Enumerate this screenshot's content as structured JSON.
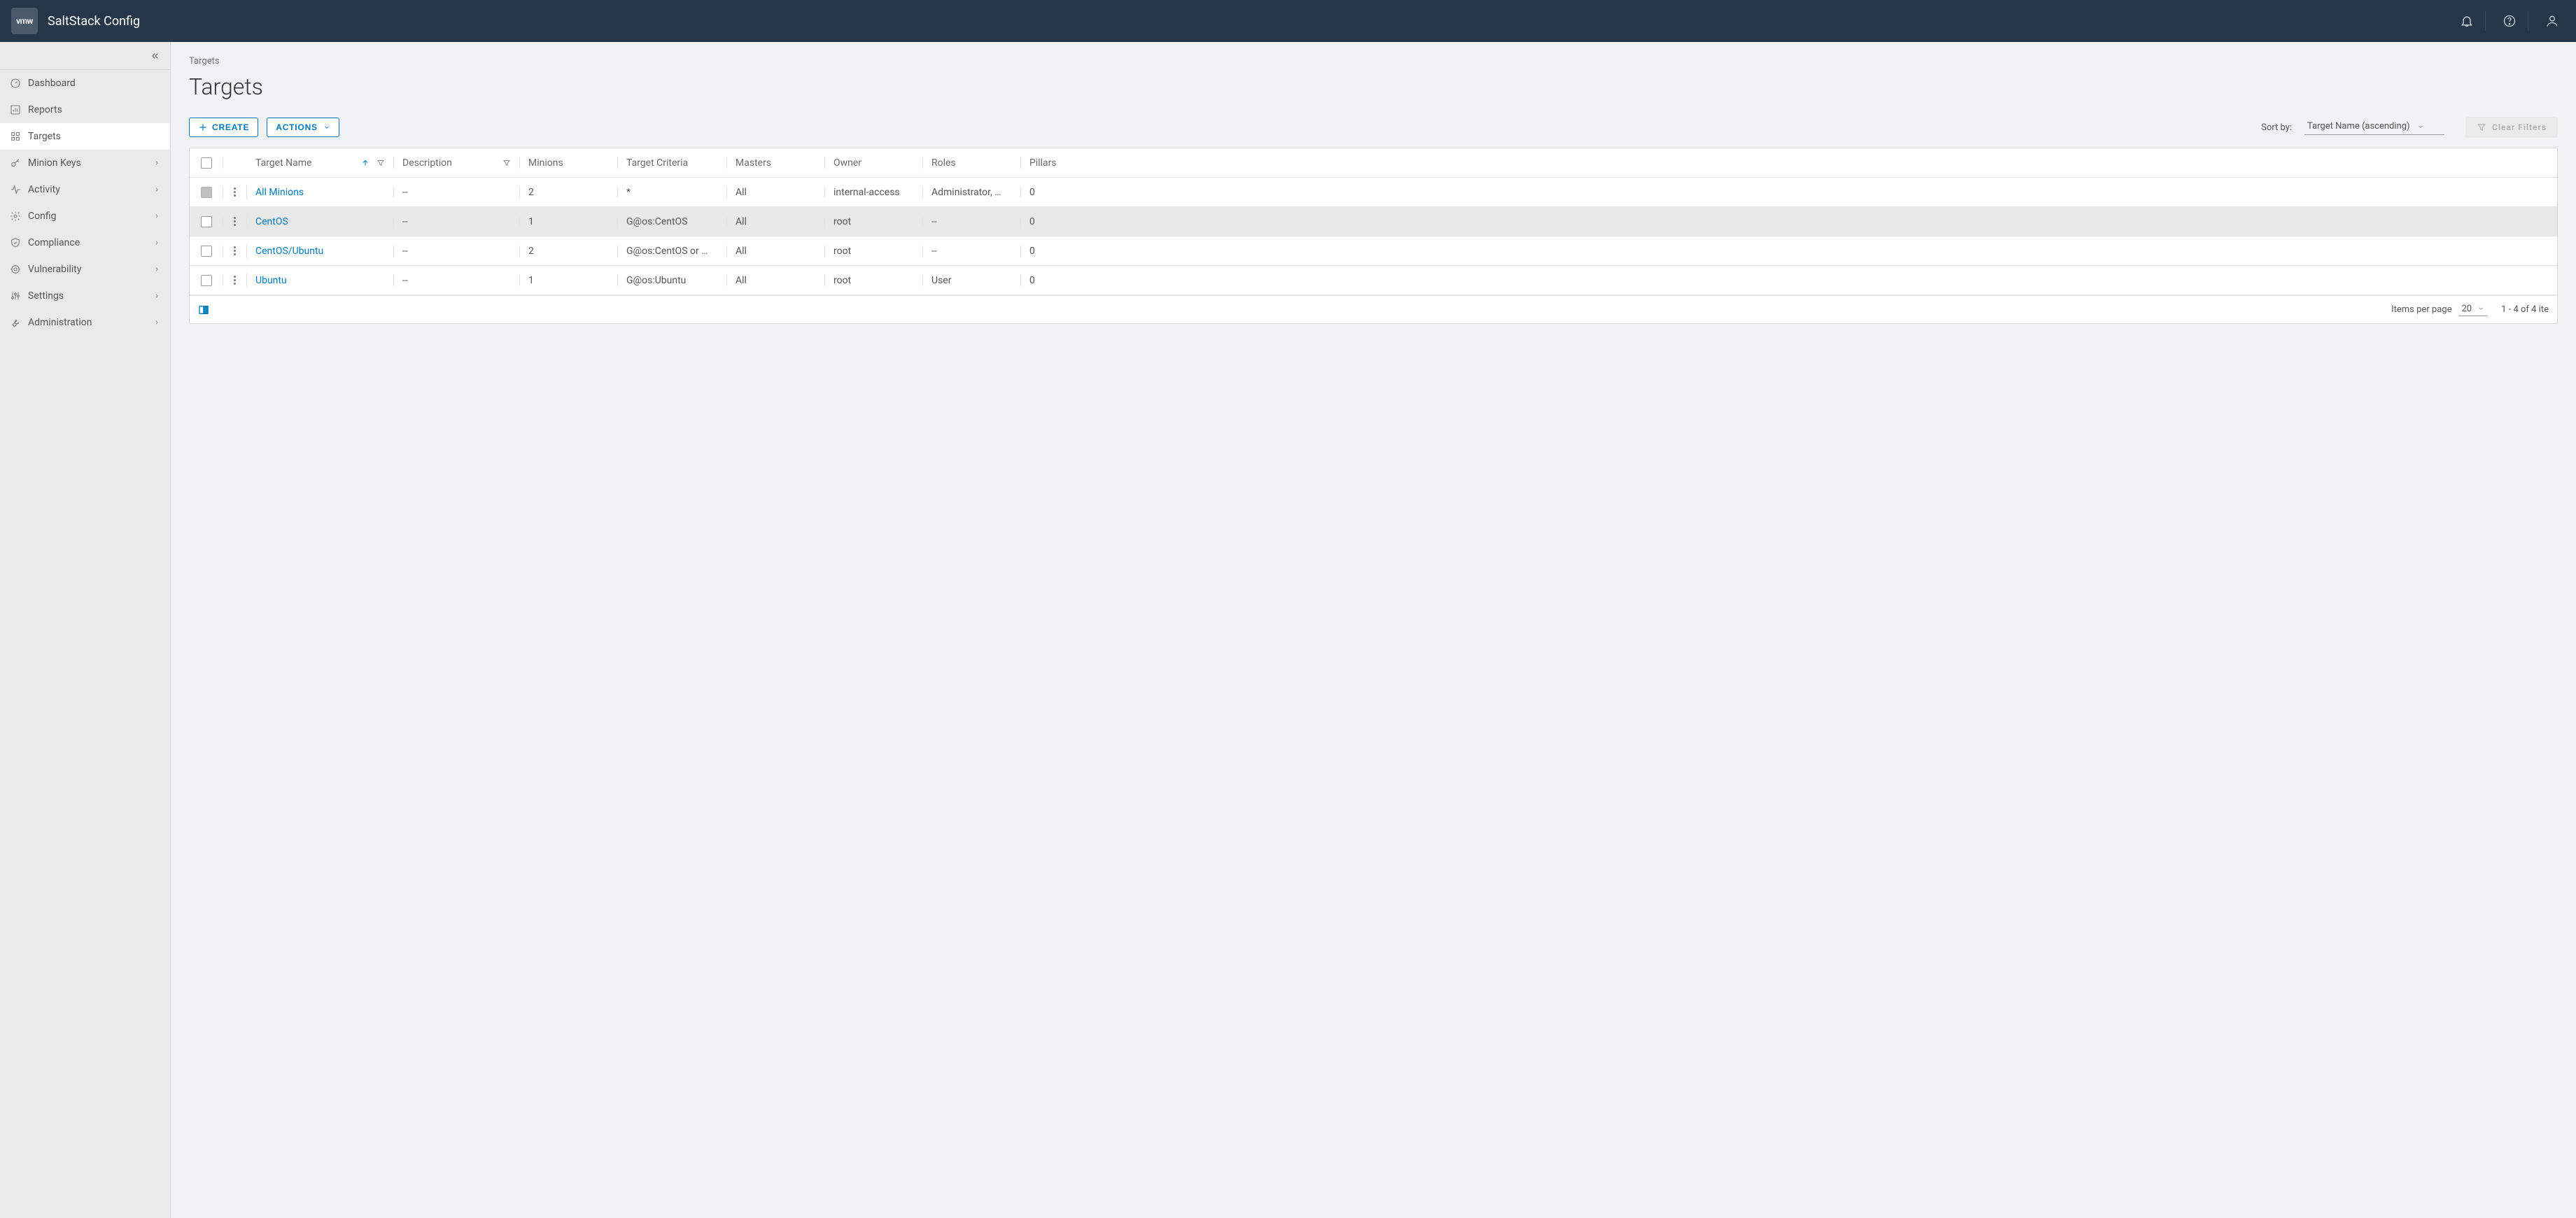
{
  "header": {
    "logo_text": "vmw",
    "app_title": "SaltStack Config"
  },
  "sidebar": {
    "items": [
      {
        "label": "Dashboard",
        "icon": "gauge-icon",
        "expandable": false
      },
      {
        "label": "Reports",
        "icon": "barchart-icon",
        "expandable": false
      },
      {
        "label": "Targets",
        "icon": "grid-icon",
        "expandable": false,
        "active": true
      },
      {
        "label": "Minion Keys",
        "icon": "key-icon",
        "expandable": true
      },
      {
        "label": "Activity",
        "icon": "activity-icon",
        "expandable": true
      },
      {
        "label": "Config",
        "icon": "gear-icon",
        "expandable": true
      },
      {
        "label": "Compliance",
        "icon": "shield-icon",
        "expandable": true
      },
      {
        "label": "Vulnerability",
        "icon": "target-icon",
        "expandable": true
      },
      {
        "label": "Settings",
        "icon": "sliders-icon",
        "expandable": true
      },
      {
        "label": "Administration",
        "icon": "wrench-icon",
        "expandable": true
      }
    ]
  },
  "breadcrumb": "Targets",
  "page_title": "Targets",
  "toolbar": {
    "create_label": "Create",
    "actions_label": "Actions",
    "sort_by_label": "Sort by:",
    "sort_value": "Target Name (ascending)",
    "clear_filters_label": "Clear Filters"
  },
  "table": {
    "columns": {
      "name": "Target Name",
      "description": "Description",
      "minions": "Minions",
      "criteria": "Target Criteria",
      "masters": "Masters",
      "owner": "Owner",
      "roles": "Roles",
      "pillars": "Pillars"
    },
    "rows": [
      {
        "name": "All Minions",
        "desc": "--",
        "minions": "2",
        "criteria": "*",
        "masters": "All",
        "owner": "internal-access",
        "roles": "Administrator, …",
        "pillars": "0",
        "disabledCheckbox": true
      },
      {
        "name": "CentOS",
        "desc": "--",
        "minions": "1",
        "criteria": "G@os:CentOS",
        "masters": "All",
        "owner": "root",
        "roles": "--",
        "pillars": "0",
        "hovered": true
      },
      {
        "name": "CentOS/Ubuntu",
        "desc": "--",
        "minions": "2",
        "criteria": "G@os:CentOS or …",
        "masters": "All",
        "owner": "root",
        "roles": "--",
        "pillars": "0"
      },
      {
        "name": "Ubuntu",
        "desc": "--",
        "minions": "1",
        "criteria": "G@os:Ubuntu",
        "masters": "All",
        "owner": "root",
        "roles": "User",
        "pillars": "0"
      }
    ]
  },
  "footer": {
    "items_per_page_label": "Items per page",
    "items_per_page_value": "20",
    "range": "1 - 4 of 4 ite"
  }
}
